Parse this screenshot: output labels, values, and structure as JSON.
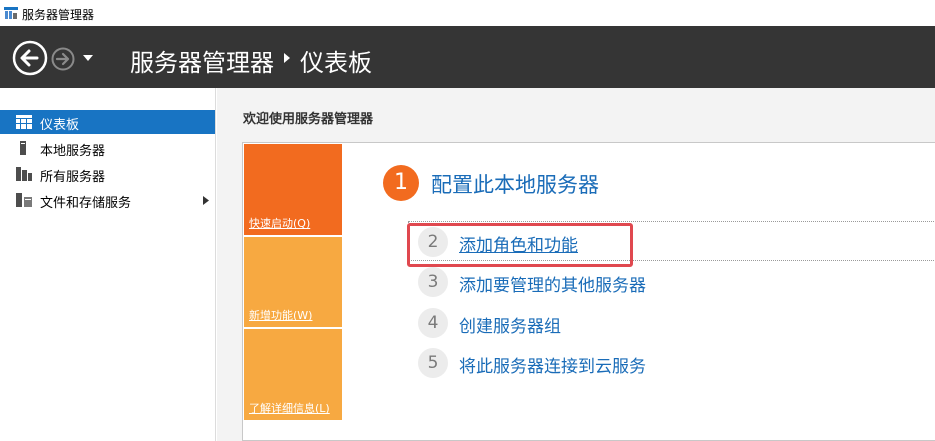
{
  "window": {
    "title": "服务器管理器"
  },
  "header": {
    "breadcrumb_root": "服务器管理器",
    "breadcrumb_current": "仪表板"
  },
  "sidebar": {
    "items": [
      {
        "label": "仪表板",
        "icon": "dashboard-icon",
        "active": true
      },
      {
        "label": "本地服务器",
        "icon": "server-icon",
        "active": false
      },
      {
        "label": "所有服务器",
        "icon": "servers-icon",
        "active": false
      },
      {
        "label": "文件和存储服务",
        "icon": "storage-icon",
        "active": false,
        "expandable": true
      }
    ]
  },
  "main": {
    "welcome": "欢迎使用服务器管理器",
    "tiles": [
      {
        "label": "快速启动(Q)",
        "color": "#f26b1f"
      },
      {
        "label": "新增功能(W)",
        "color": "#f7a941"
      },
      {
        "label": "了解详细信息(L)",
        "color": "#f7a941"
      }
    ],
    "step1": {
      "number": "1",
      "title": "配置此本地服务器"
    },
    "steps": [
      {
        "number": "2",
        "label": "添加角色和功能"
      },
      {
        "number": "3",
        "label": "添加要管理的其他服务器"
      },
      {
        "number": "4",
        "label": "创建服务器组"
      },
      {
        "number": "5",
        "label": "将此服务器连接到云服务"
      }
    ]
  },
  "colors": {
    "header_bg": "#353535",
    "accent_blue": "#1874c3",
    "orange": "#f26b1f",
    "light_orange": "#f7a941",
    "highlight_red": "#e0484f"
  }
}
